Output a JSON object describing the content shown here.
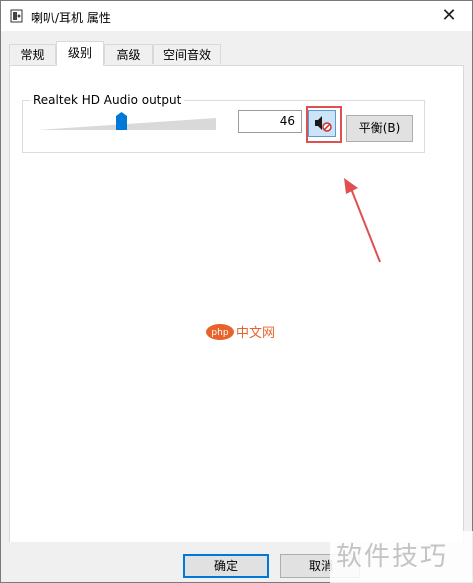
{
  "window": {
    "title": "喇叭/耳机 属性",
    "close_glyph": "✕"
  },
  "tabs": [
    {
      "label": "常规",
      "active": false
    },
    {
      "label": "级别",
      "active": true
    },
    {
      "label": "高级",
      "active": false
    },
    {
      "label": "空间音效",
      "active": false
    }
  ],
  "levels": {
    "device_name": "Realtek HD Audio output",
    "volume_value": "46",
    "volume_fraction": 0.46,
    "mute_icon": "speaker-muted-icon",
    "balance_label": "平衡(B)"
  },
  "footer": {
    "ok_label": "确定",
    "cancel_label": "取消"
  },
  "watermarks": {
    "center_logo_text": "php中文网",
    "corner_text": "软件技巧"
  },
  "colors": {
    "highlight": "#e05050",
    "accent": "#0078d7",
    "slider_thumb": "#0078d7"
  }
}
